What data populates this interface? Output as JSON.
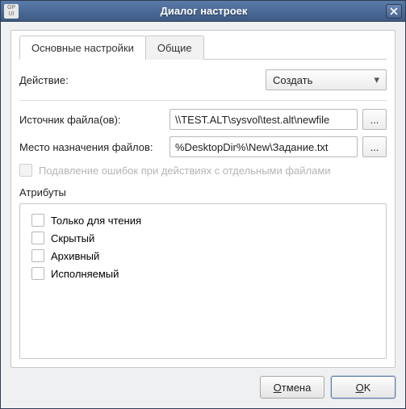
{
  "titlebar": {
    "icon_text": "GP\nUI",
    "title": "Диалог настроек"
  },
  "tabs": {
    "main": "Основные настройки",
    "general": "Общие"
  },
  "action": {
    "label": "Действие:",
    "value": "Создать"
  },
  "source": {
    "label": "Источник файла(ов):",
    "value": "\\\\TEST.ALT\\sysvol\\test.alt\\newfile",
    "browse": "..."
  },
  "dest": {
    "label": "Место назначения файлов:",
    "value": "%DesktopDir%\\New\\Задание.txt",
    "browse": "..."
  },
  "suppress": {
    "label": "Подавление ошибок при действиях с отдельными файлами"
  },
  "attributes": {
    "label": "Атрибуты",
    "readonly": "Только для чтения",
    "hidden": "Скрытый",
    "archive": "Архивный",
    "exec": "Исполняемый"
  },
  "footer": {
    "cancel": "Отмена",
    "ok": "OK"
  }
}
